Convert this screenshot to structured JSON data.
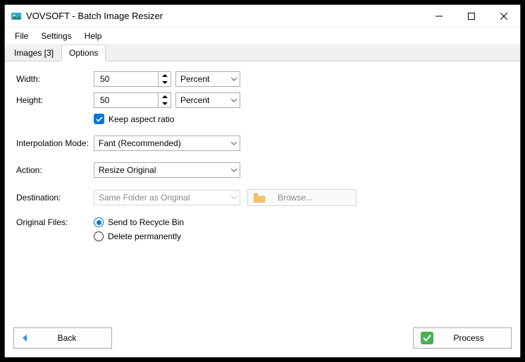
{
  "titlebar": {
    "title": "VOVSOFT - Batch Image Resizer"
  },
  "menu": {
    "file": "File",
    "settings": "Settings",
    "help": "Help"
  },
  "tabs": {
    "images": "Images [3]",
    "options": "Options"
  },
  "labels": {
    "width": "Width:",
    "height": "Height:",
    "keep_aspect": "Keep aspect ratio",
    "interp": "Interpolation Mode:",
    "action": "Action:",
    "destination": "Destination:",
    "original_files": "Original Files:",
    "recycle": "Send to Recycle Bin",
    "delete_perm": "Delete permanently",
    "browse": "Browse..."
  },
  "values": {
    "width": "50",
    "height": "50",
    "width_unit": "Percent",
    "height_unit": "Percent",
    "interp": "Fant (Recommended)",
    "action": "Resize Original",
    "destination": "Same Folder as Original"
  },
  "buttons": {
    "back": "Back",
    "process": "Process"
  }
}
